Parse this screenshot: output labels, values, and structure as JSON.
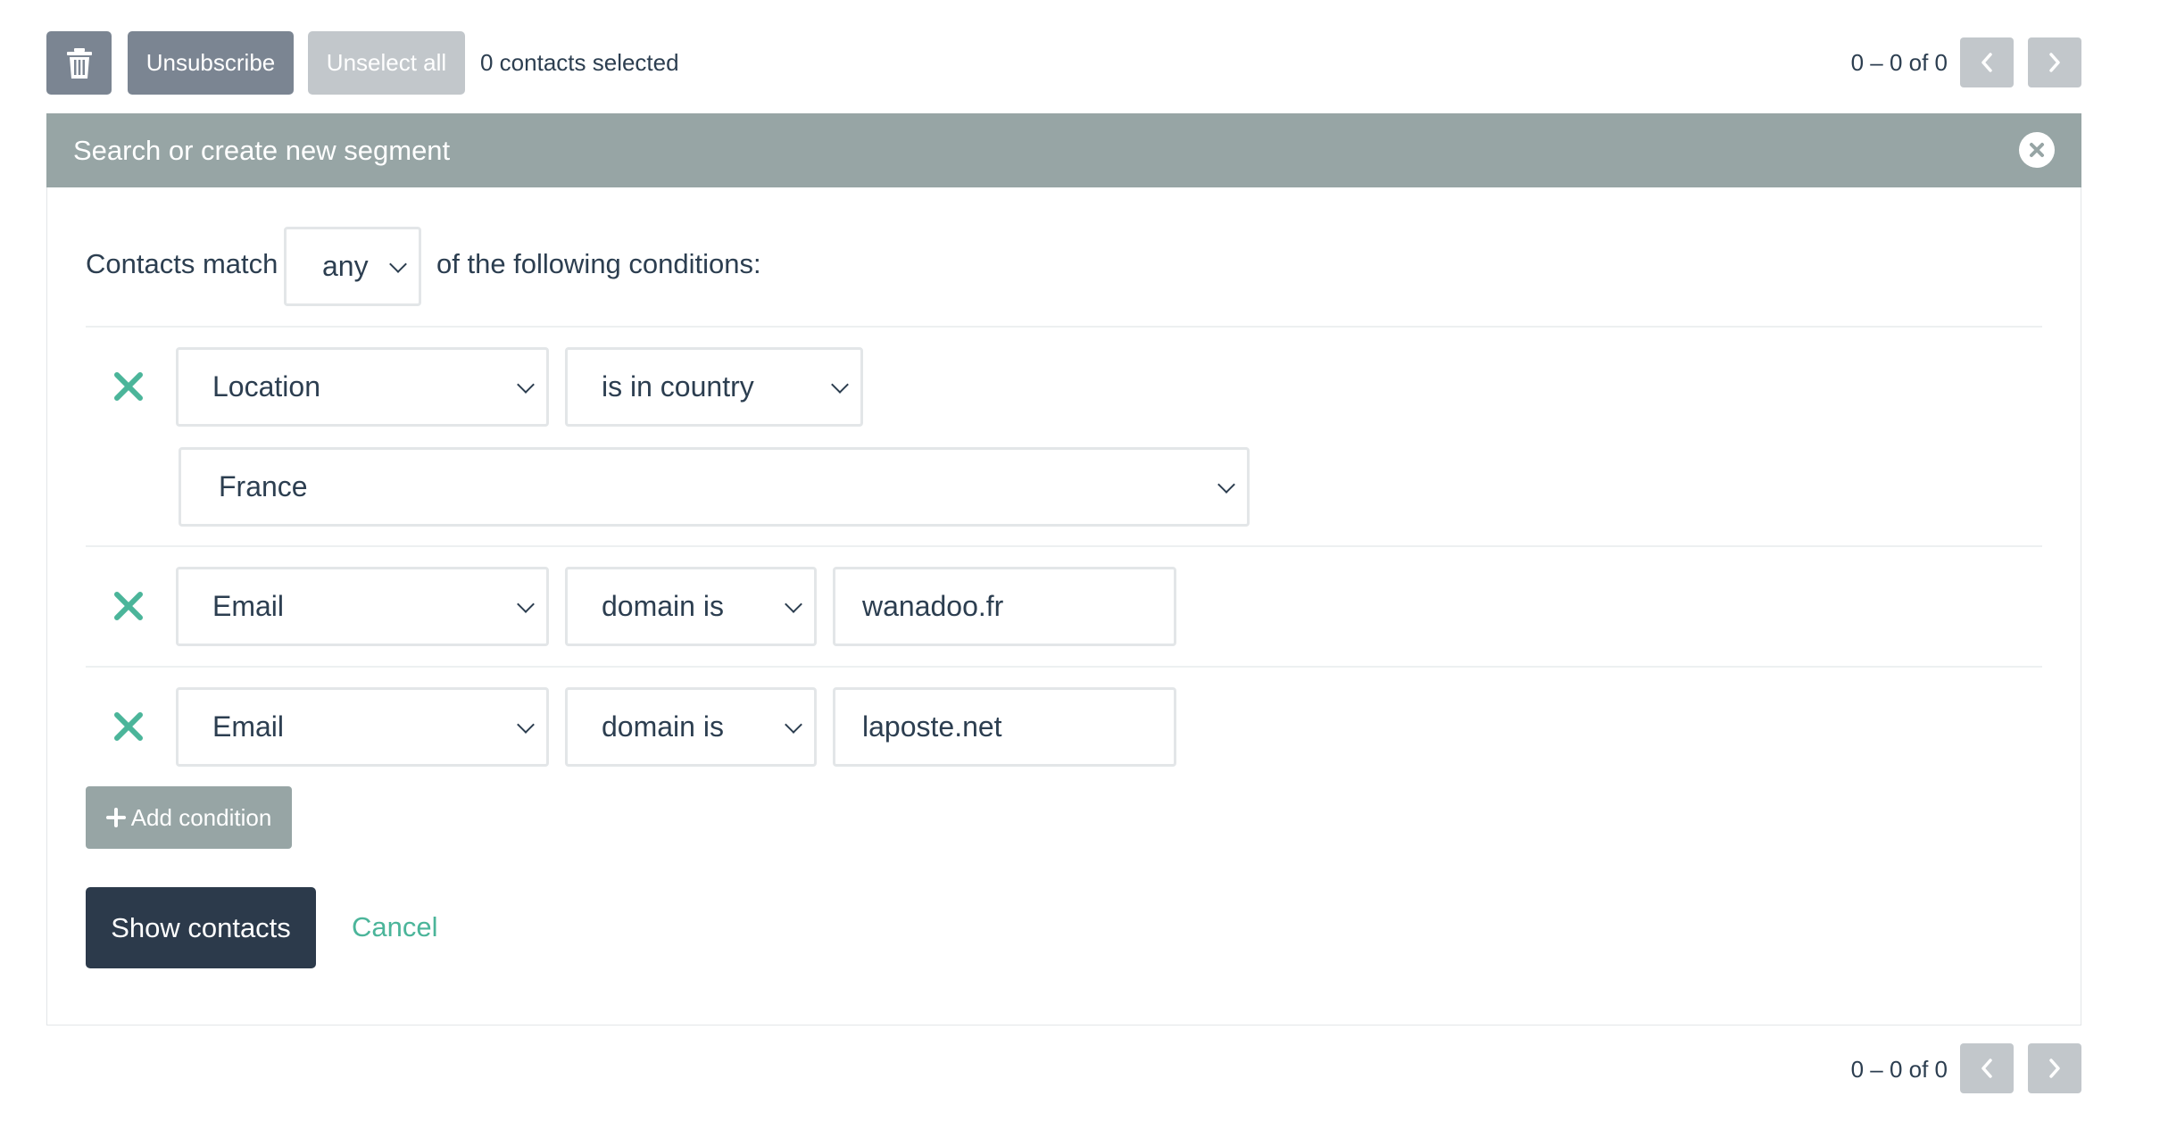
{
  "toolbar": {
    "trash_icon": "trash-icon",
    "unsubscribe_label": "Unsubscribe",
    "unselect_all_label": "Unselect all",
    "selected_count": "0 contacts selected"
  },
  "pagination_top": {
    "range": "0 – 0 of 0",
    "prev_icon": "chevron-left-icon",
    "next_icon": "chevron-right-icon"
  },
  "pagination_bottom": {
    "range": "0 – 0 of 0",
    "prev_icon": "chevron-left-icon",
    "next_icon": "chevron-right-icon"
  },
  "segment": {
    "title": "Search or create new segment",
    "close_icon": "close-circle-icon",
    "match_prefix": "Contacts match",
    "match_value": "any",
    "match_suffix": "of the following conditions:",
    "conditions": [
      {
        "field": "Location",
        "operator": "is in country",
        "value": "France"
      },
      {
        "field": "Email",
        "operator": "domain is",
        "value": "wanadoo.fr"
      },
      {
        "field": "Email",
        "operator": "domain is",
        "value": "laposte.net"
      }
    ],
    "add_condition_label": "Add condition",
    "show_contacts_label": "Show contacts",
    "cancel_label": "Cancel"
  },
  "colors": {
    "primary_dark": "#2c3a4b",
    "accent_green": "#4bb59a",
    "header_gray": "#97a5a5",
    "button_gray": "#7b8592",
    "disabled_gray": "#c2c7cb"
  }
}
